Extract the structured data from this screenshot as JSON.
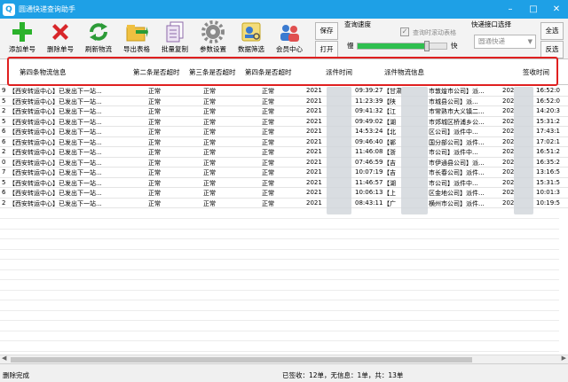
{
  "window": {
    "title": "圆通快递查询助手"
  },
  "toolbar": {
    "buttons": [
      {
        "label": "添加单号"
      },
      {
        "label": "删除单号"
      },
      {
        "label": "刷新物流"
      },
      {
        "label": "导出表格"
      },
      {
        "label": "批量复制"
      },
      {
        "label": "参数设置"
      },
      {
        "label": "数据筛选"
      },
      {
        "label": "会员中心"
      }
    ],
    "save_label": "保存",
    "open_label": "打开",
    "speed_group_label": "查询速度",
    "slow_label": "慢",
    "fast_label": "快",
    "scroll_check_label": "查询时滚动表格",
    "speed_level": 0.78,
    "api_group_label": "快递接口选择",
    "api_selected": "圆通快递",
    "select_all_label": "全选",
    "invert_label": "反选"
  },
  "table": {
    "columns": [
      "第四条物流信息",
      "第二条是否超时",
      "第三条是否超时",
      "第四条是否超时",
      "派件时间",
      "派件物流信息",
      "签收时间"
    ],
    "rows": [
      {
        "idx": "9",
        "info": "【西安转运中心】已发出下一站...",
        "c2": "正常",
        "c3": "正常",
        "c4": "正常",
        "dt": "2021",
        "tm": "09:39:27",
        "pinfo": "【甘肃",
        "pinfo2": "市敦煌市公司】派...",
        "sign": "202",
        "signt": "16:52:0"
      },
      {
        "idx": "5",
        "info": "【西安转运中心】已发出下一站...",
        "c2": "正常",
        "c3": "正常",
        "c4": "正常",
        "dt": "2021",
        "tm": "11:23:39",
        "pinfo": "【陕",
        "pinfo2": "市城县公司】派...",
        "sign": "202",
        "signt": "16:52:0"
      },
      {
        "idx": "2",
        "info": "【西安转运中心】已发出下一站...",
        "c2": "正常",
        "c3": "正常",
        "c4": "正常",
        "dt": "2021",
        "tm": "09:41:32",
        "pinfo": "【江",
        "pinfo2": "市常熟市大义镇二...",
        "sign": "202",
        "signt": "14:20:3"
      },
      {
        "idx": "5",
        "info": "【西安转运中心】已发出下一站...",
        "c2": "正常",
        "c3": "正常",
        "c4": "正常",
        "dt": "2021",
        "tm": "09:49:02",
        "pinfo": "【湖",
        "pinfo2": "市郊城区桥浦乡公...",
        "sign": "202",
        "signt": "15:31:2"
      },
      {
        "idx": "6",
        "info": "【西安转运中心】已发出下一站...",
        "c2": "正常",
        "c3": "正常",
        "c4": "正常",
        "dt": "2021",
        "tm": "14:53:24",
        "pinfo": "【北",
        "pinfo2": "区公司】派件中...",
        "sign": "202",
        "signt": "17:43:1"
      },
      {
        "idx": "6",
        "info": "【西安转运中心】已发出下一站...",
        "c2": "正常",
        "c3": "正常",
        "c4": "正常",
        "dt": "2021",
        "tm": "09:46:40",
        "pinfo": "【郸",
        "pinfo2": "国分部公司】派件...",
        "sign": "202",
        "signt": "17:02:1"
      },
      {
        "idx": "2",
        "info": "【西安转运中心】已发出下一站...",
        "c2": "正常",
        "c3": "正常",
        "c4": "正常",
        "dt": "2021",
        "tm": "11:46:08",
        "pinfo": "【浙",
        "pinfo2": "市公司】派件中...",
        "sign": "202",
        "signt": "16:51:2"
      },
      {
        "idx": "0",
        "info": "【西安转运中心】已发出下一站...",
        "c2": "正常",
        "c3": "正常",
        "c4": "正常",
        "dt": "2021",
        "tm": "07:46:59",
        "pinfo": "【吉",
        "pinfo2": "市伊通县公司】派...",
        "sign": "202",
        "signt": "16:35:2"
      },
      {
        "idx": "7",
        "info": "【西安转运中心】已发出下一站...",
        "c2": "正常",
        "c3": "正常",
        "c4": "正常",
        "dt": "2021",
        "tm": "10:07:19",
        "pinfo": "【吉",
        "pinfo2": "市长春公司】派件...",
        "sign": "202",
        "signt": "13:16:5"
      },
      {
        "idx": "5",
        "info": "【西安转运中心】已发出下一站...",
        "c2": "正常",
        "c3": "正常",
        "c4": "正常",
        "dt": "2021",
        "tm": "11:46:57",
        "pinfo": "【湖",
        "pinfo2": "市公司】派件中...",
        "sign": "202",
        "signt": "15:31:5"
      },
      {
        "idx": "6",
        "info": "【西安转运中心】已发出下一站...",
        "c2": "正常",
        "c3": "正常",
        "c4": "正常",
        "dt": "2021",
        "tm": "10:06:13",
        "pinfo": "【上",
        "pinfo2": "区金地公司】派件...",
        "sign": "202",
        "signt": "10:01:3"
      },
      {
        "idx": "2",
        "info": "【西安转运中心】已发出下一站...",
        "c2": "正常",
        "c3": "正常",
        "c4": "正常",
        "dt": "2021",
        "tm": "08:43:11",
        "pinfo": "【广",
        "pinfo2": "横州市公司】派件...",
        "sign": "202",
        "signt": "10:19:5"
      }
    ]
  },
  "status": {
    "left": "删除完成",
    "right": "已签收：12单，无信息：1单，共：13单"
  }
}
